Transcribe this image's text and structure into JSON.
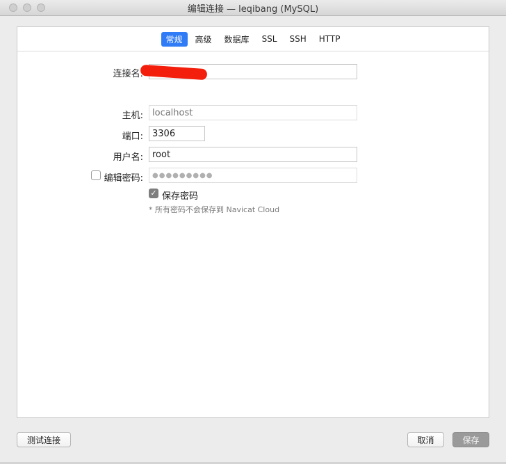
{
  "window": {
    "title": "编辑连接 — leqibang (MySQL)"
  },
  "tabs": [
    {
      "label": "常规",
      "active": true
    },
    {
      "label": "高级",
      "active": false
    },
    {
      "label": "数据库",
      "active": false
    },
    {
      "label": "SSL",
      "active": false
    },
    {
      "label": "SSH",
      "active": false
    },
    {
      "label": "HTTP",
      "active": false
    }
  ],
  "form": {
    "connection_name_label": "连接名:",
    "connection_name_value": "",
    "host_label": "主机:",
    "host_placeholder": "localhost",
    "port_label": "端口:",
    "port_value": "3306",
    "username_label": "用户名:",
    "username_value": "root",
    "edit_password_label": "编辑密码:",
    "password_value": "●●●●●●●●●",
    "save_password_label": "保存密码",
    "note": "* 所有密码不会保存到 Navicat Cloud"
  },
  "buttons": {
    "test": "测试连接",
    "cancel": "取消",
    "save": "保存"
  },
  "colors": {
    "accent": "#2f7cf6",
    "redaction": "#f31e0c"
  }
}
